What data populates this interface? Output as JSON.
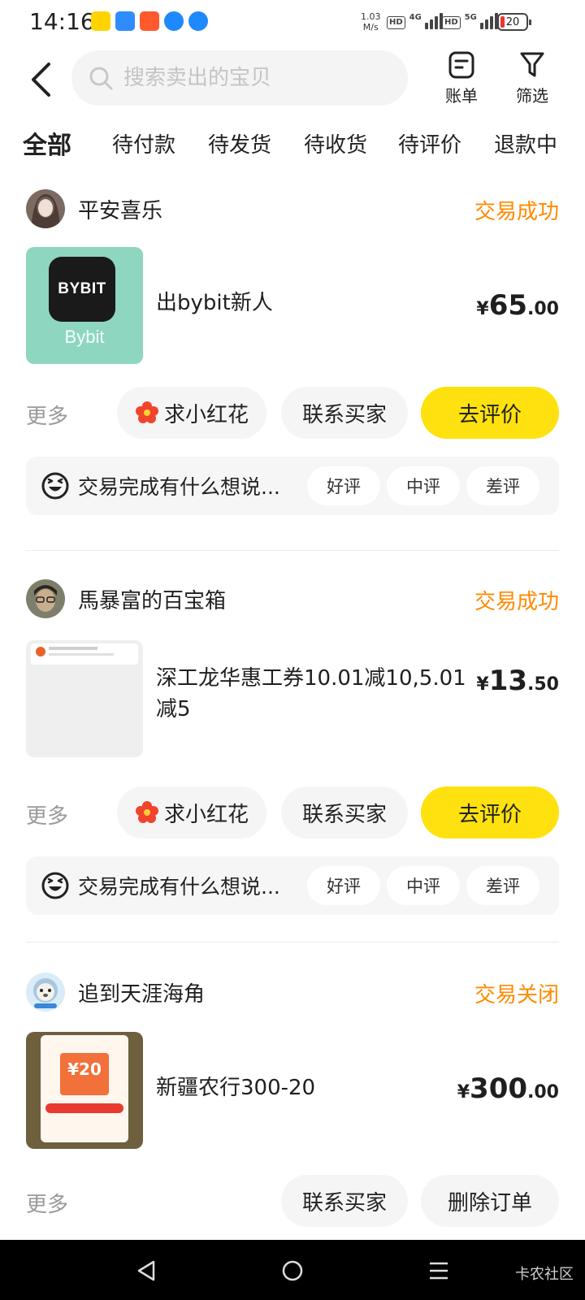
{
  "status_bar": {
    "time": "14:16",
    "net_speed_value": "1.03",
    "net_speed_unit": "M/s",
    "net1": "4G",
    "net2": "5G",
    "hd": "HD",
    "battery": "20"
  },
  "header": {
    "search_placeholder": "搜索卖出的宝贝",
    "bill_label": "账单",
    "filter_label": "筛选"
  },
  "tabs": [
    "全部",
    "待付款",
    "待发货",
    "待收货",
    "待评价",
    "退款中"
  ],
  "orders": [
    {
      "seller": "平安喜乐",
      "status": "交易成功",
      "title": "出bybit新人",
      "thumb_brand": "BYBIT",
      "thumb_caption": "Bybit",
      "price_currency": "¥",
      "price_int": "65",
      "price_dec": ".00",
      "more": "更多",
      "btn_flower": "求小红花",
      "btn_contact": "联系买家",
      "btn_primary": "去评价",
      "review_prompt": "交易完成有什么想说...",
      "chips": [
        "好评",
        "中评",
        "差评"
      ]
    },
    {
      "seller": "馬暴富的百宝箱",
      "status": "交易成功",
      "title_line1": "深工龙华惠工券10.01减10,5.01",
      "title_line2": "减5",
      "price_currency": "¥",
      "price_int": "13",
      "price_dec": ".50",
      "more": "更多",
      "btn_flower": "求小红花",
      "btn_contact": "联系买家",
      "btn_primary": "去评价",
      "review_prompt": "交易完成有什么想说...",
      "chips": [
        "好评",
        "中评",
        "差评"
      ]
    },
    {
      "seller": "追到天涯海角",
      "status": "交易关闭",
      "title": "新疆农行300-20",
      "thumb_amount": "¥20",
      "price_currency": "¥",
      "price_int": "300",
      "price_dec": ".00",
      "more": "更多",
      "btn_contact": "联系买家",
      "btn_delete": "删除订单"
    }
  ],
  "watermark": "卡农社区",
  "colors": {
    "accent_yellow": "#ffe10f",
    "status_orange": "#ff8a00",
    "muted_text": "#9a9a9a"
  }
}
